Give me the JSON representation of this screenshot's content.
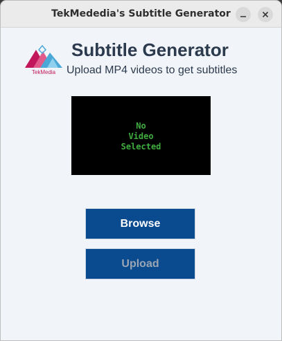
{
  "window": {
    "title": "TekMededia's Subtitle Generator",
    "minimize_icon": "minimize-icon",
    "close_icon": "close-icon"
  },
  "header": {
    "logo_text": "TekMedia",
    "title": "Subtitle Generator",
    "subtitle": "Upload MP4 videos to get subtitles"
  },
  "video_preview": {
    "placeholder_lines": [
      "No",
      "Video",
      "Selected"
    ]
  },
  "actions": {
    "browse_label": "Browse",
    "upload_label": "Upload"
  },
  "status": {
    "text": ""
  },
  "colors": {
    "background": "#f1f4f9",
    "button": "#0a4a8f",
    "title_text": "#2b3a4c",
    "placeholder_text": "#3fae3f",
    "upload_disabled_text": "#9aa6b4"
  }
}
